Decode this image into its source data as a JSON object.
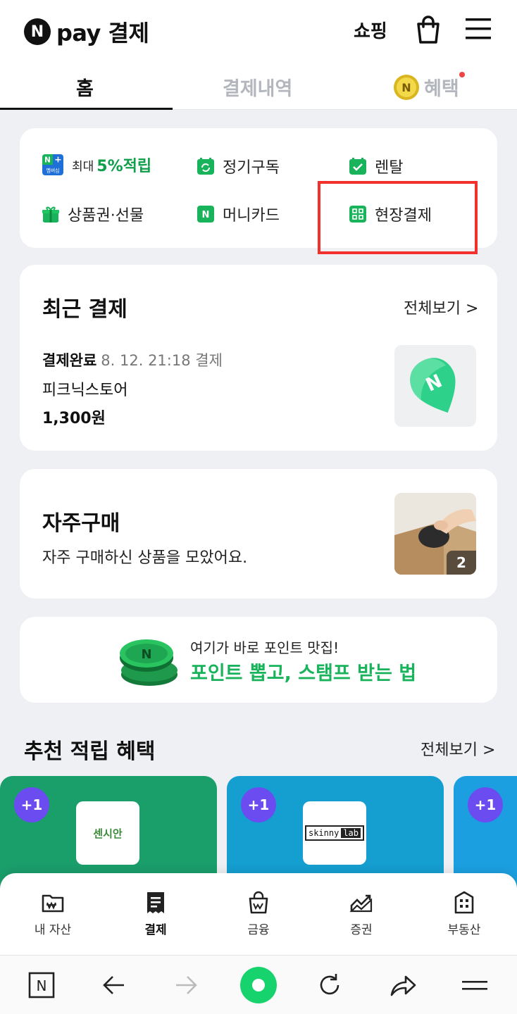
{
  "header": {
    "logo_n": "N",
    "logo_text": "pay 결제",
    "shopping_label": "쇼핑"
  },
  "tabs": [
    {
      "label": "홈",
      "active": true
    },
    {
      "label": "결제내역",
      "active": false
    },
    {
      "label": "혜택",
      "active": false,
      "has_notification_dot": true
    }
  ],
  "quick_menu": {
    "items": [
      {
        "icon": "n-plus-membership-icon",
        "prefix": "최대",
        "label": "5%적립",
        "badge": "멤버십"
      },
      {
        "icon": "subscription-icon",
        "label": "정기구독"
      },
      {
        "icon": "rental-icon",
        "label": "렌탈"
      },
      {
        "icon": "gift-icon",
        "label": "상품권·선물"
      },
      {
        "icon": "money-card-icon",
        "label": "머니카드"
      },
      {
        "icon": "qr-pay-icon",
        "label": "현장결제",
        "highlighted": true
      }
    ]
  },
  "recent_payment": {
    "title": "최근 결제",
    "see_all": "전체보기 >",
    "status": "결제완료",
    "datetime": "8. 12. 21:18 결제",
    "store": "피크닉스토어",
    "amount": "1,300원"
  },
  "frequent": {
    "title": "자주구매",
    "subtitle": "자주 구매하신 상품을 모았어요.",
    "count": "2"
  },
  "promo_banner": {
    "line1": "여기가 바로 포인트 맛집!",
    "line2": "포인트 뽑고, 스탬프 받는 법"
  },
  "recommended": {
    "title": "추천 적립 혜택",
    "see_all": "전체보기 >",
    "cards": [
      {
        "badge": "+1",
        "brand": "센시안"
      },
      {
        "badge": "+1",
        "brand_a": "skinny",
        "brand_b": "lab"
      },
      {
        "badge": "+1"
      }
    ]
  },
  "bottom_nav": [
    {
      "label": "내 자산",
      "icon": "wallet-icon"
    },
    {
      "label": "결제",
      "icon": "receipt-icon",
      "active": true
    },
    {
      "label": "금융",
      "icon": "money-bag-icon"
    },
    {
      "label": "증권",
      "icon": "stock-chart-icon"
    },
    {
      "label": "부동산",
      "icon": "building-icon"
    }
  ],
  "browser_bar": {
    "n_button": "N"
  },
  "colors": {
    "green": "#18b35a",
    "highlight_red": "#f2312c",
    "badge_purple": "#6b4cf0"
  }
}
